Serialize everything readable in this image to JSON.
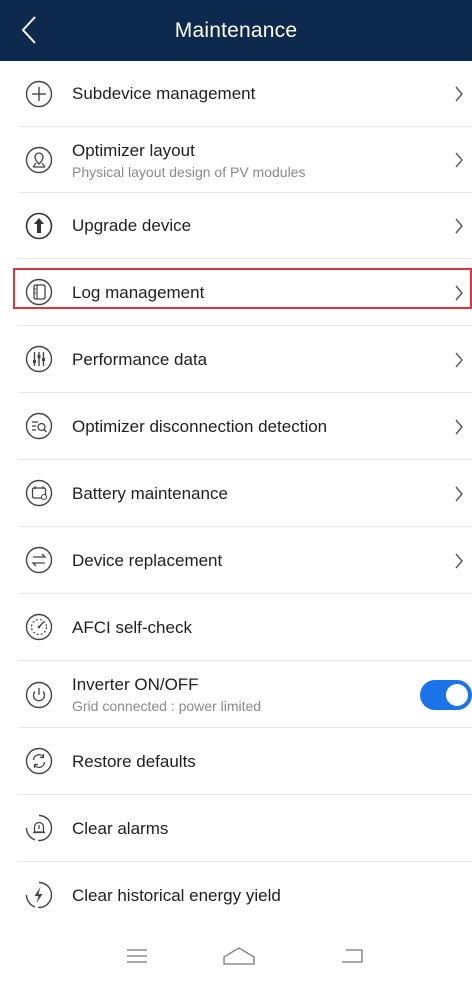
{
  "header": {
    "title": "Maintenance",
    "back_icon": "chevron-left-icon"
  },
  "items": [
    {
      "icon": "plus-circle-icon",
      "label": "Subdevice management",
      "chevron": true
    },
    {
      "icon": "map-pin-circle-icon",
      "label": "Optimizer layout",
      "sub": "Physical layout design of PV modules",
      "chevron": true
    },
    {
      "icon": "upload-arrow-circle-icon",
      "label": "Upgrade device",
      "chevron": true,
      "highlighted": true
    },
    {
      "icon": "log-document-icon",
      "label": "Log management",
      "chevron": true
    },
    {
      "icon": "sliders-icon",
      "label": "Performance data",
      "chevron": true
    },
    {
      "icon": "list-search-icon",
      "label": "Optimizer disconnection detection",
      "chevron": true
    },
    {
      "icon": "battery-calendar-icon",
      "label": "Battery maintenance",
      "chevron": true
    },
    {
      "icon": "swap-arrows-icon",
      "label": "Device replacement",
      "chevron": true
    },
    {
      "icon": "gauge-check-icon",
      "label": "AFCI self-check",
      "chevron": false
    },
    {
      "icon": "power-icon",
      "label": "Inverter ON/OFF",
      "sub": "Grid connected : power limited",
      "toggle": true,
      "toggle_on": true
    },
    {
      "icon": "restore-icon",
      "label": "Restore defaults",
      "chevron": false
    },
    {
      "icon": "alarm-bell-icon",
      "label": "Clear alarms",
      "chevron": false
    },
    {
      "icon": "lightning-icon",
      "label": "Clear historical energy yield",
      "chevron": false
    }
  ],
  "colors": {
    "header_bg": "#0d2a4e",
    "accent": "#1a73e8",
    "highlight_border": "#d9363e"
  },
  "navbar": {
    "menu_icon": "menu-icon",
    "home_icon": "home-icon",
    "back_icon": "back-icon"
  }
}
